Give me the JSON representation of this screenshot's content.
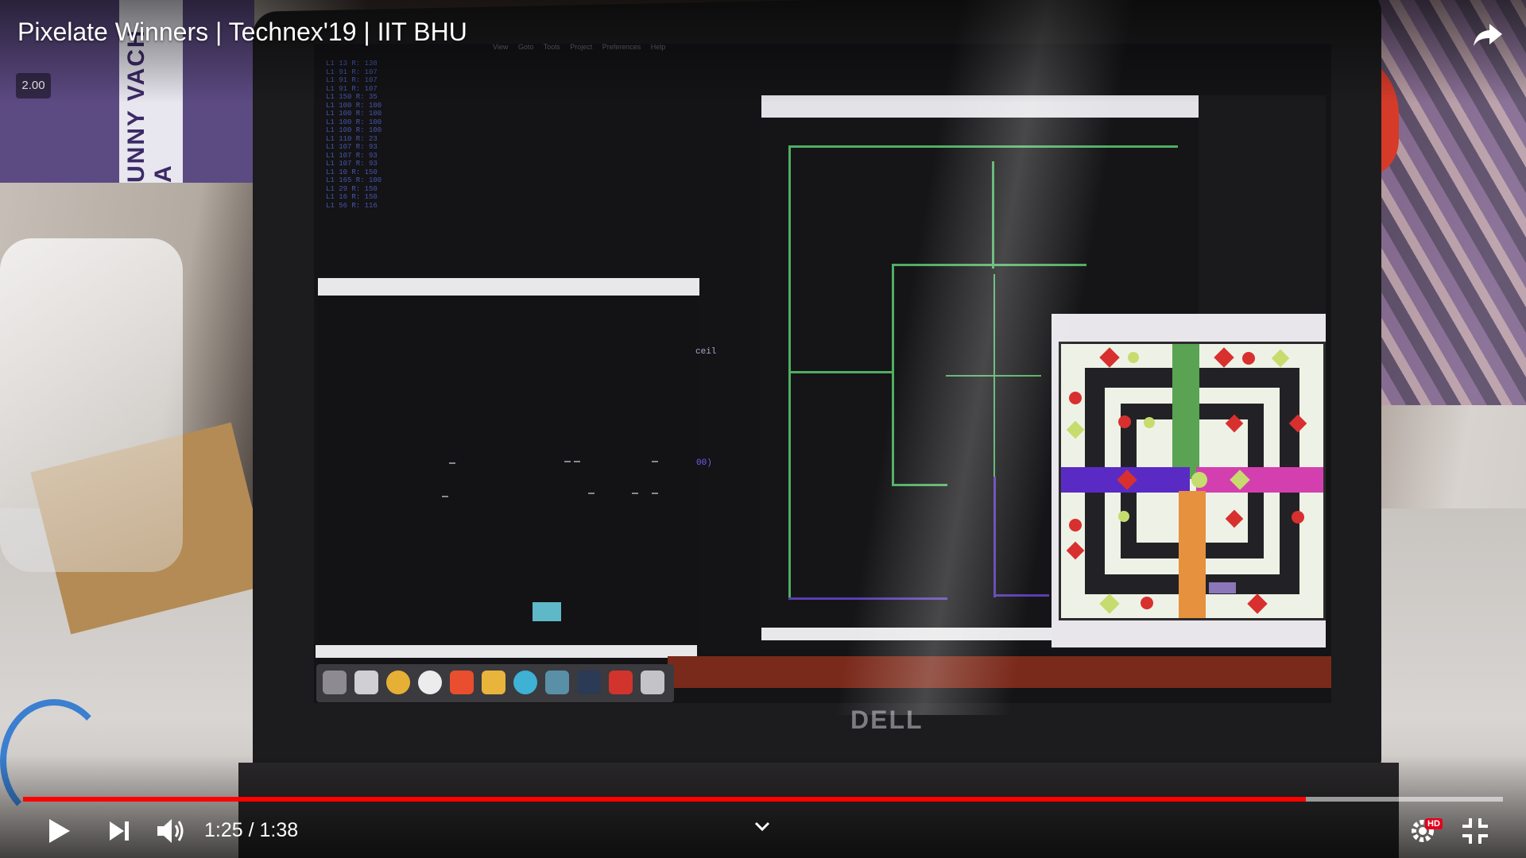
{
  "video": {
    "title": "Pixelate Winners | Technex'19 | IIT BHU",
    "playback_speed": "2.00",
    "current_time": "1:25",
    "duration": "1:38",
    "time_display": "1:25 / 1:38",
    "progress": 0.867,
    "quality_badge": "HD"
  },
  "scene": {
    "poster_text": "UNNY VACH A",
    "laptop_brand": "DELL",
    "screen_small_text_1": "ceil",
    "screen_small_text_2": "00)"
  },
  "controls": {
    "play_icon": "play-icon",
    "next_icon": "next-icon",
    "volume_icon": "volume-icon",
    "share_icon": "share-icon",
    "settings_icon": "gear-icon",
    "fullscreen_icon": "exit-fullscreen-icon",
    "chevron_icon": "chevron-down-icon"
  },
  "colors": {
    "progress_played": "#ff0000",
    "overlay_text": "#ffffff"
  }
}
